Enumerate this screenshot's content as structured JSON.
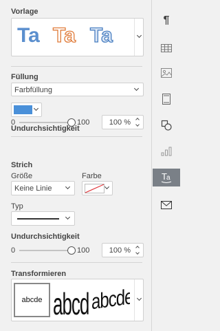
{
  "template": {
    "heading": "Vorlage",
    "samples": [
      "Ta",
      "Ta",
      "Ta"
    ],
    "colors": {
      "blue_fill": "#5b8fce",
      "orange_stroke": "#e07b39",
      "blue_stroke": "#4a7fc1"
    }
  },
  "fill": {
    "heading": "Füllung",
    "type_value": "Farbfüllung",
    "color": "#4a90d9",
    "opacity_label": "Undurchsichtigkeit",
    "slider_min": "0",
    "slider_max": "100",
    "opacity_value": "100 %",
    "opacity_level": 100
  },
  "stroke": {
    "heading": "Strich",
    "size_label": "Größe",
    "size_value": "Keine Linie",
    "color_label": "Farbe",
    "type_label": "Typ",
    "opacity_label": "Undurchsichtigkeit",
    "slider_min": "0",
    "slider_max": "100",
    "opacity_value": "100 %",
    "opacity_level": 100
  },
  "transform": {
    "heading": "Transformieren",
    "samples": [
      "abcde",
      "abcde",
      "abcde"
    ]
  },
  "rail": {
    "icons": [
      "paragraph-icon",
      "table-icon",
      "image-icon",
      "header-footer-icon",
      "shape-icon",
      "chart-icon",
      "text-art-icon",
      "mail-merge-icon"
    ],
    "paragraph_glyph": "¶"
  }
}
